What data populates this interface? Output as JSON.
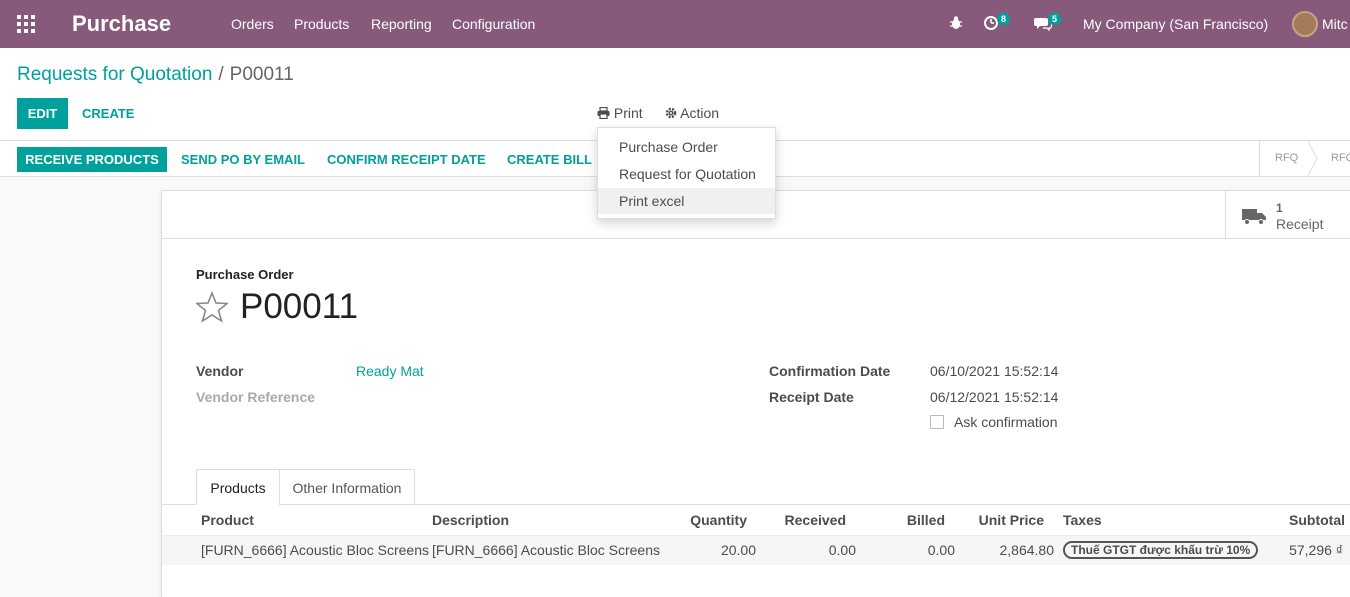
{
  "navbar": {
    "app_name": "Purchase",
    "menus": [
      "Orders",
      "Products",
      "Reporting",
      "Configuration"
    ],
    "activity_count": "8",
    "message_count": "5",
    "company": "My Company (San Francisco)",
    "user": "Mitc"
  },
  "breadcrumb": {
    "parent": "Requests for Quotation",
    "separator": "/",
    "current": "P00011"
  },
  "toolbar": {
    "edit_label": "EDIT",
    "create_label": "CREATE",
    "print_label": "Print",
    "action_label": "Action"
  },
  "print_menu": {
    "items": [
      "Purchase Order",
      "Request for Quotation",
      "Print excel"
    ]
  },
  "statusbar": {
    "buttons": [
      "RECEIVE PRODUCTS",
      "SEND PO BY EMAIL",
      "CONFIRM RECEIPT DATE",
      "CREATE BILL"
    ],
    "stages": [
      "RFQ",
      "RFQ"
    ]
  },
  "smart_button": {
    "count": "1",
    "label": "Receipt"
  },
  "form": {
    "title_label": "Purchase Order",
    "name": "P00011",
    "vendor_label": "Vendor",
    "vendor_value": "Ready Mat",
    "vendor_ref_label": "Vendor Reference",
    "confirmation_date_label": "Confirmation Date",
    "confirmation_date_value": "06/10/2021 15:52:14",
    "receipt_date_label": "Receipt Date",
    "receipt_date_value": "06/12/2021 15:52:14",
    "ask_confirmation_label": "Ask confirmation"
  },
  "tabs": [
    "Products",
    "Other Information"
  ],
  "table": {
    "headers": [
      "Product",
      "Description",
      "Quantity",
      "Received",
      "Billed",
      "Unit Price",
      "Taxes",
      "Subtotal"
    ],
    "rows": [
      {
        "product": "[FURN_6666] Acoustic Bloc Screens",
        "description": "[FURN_6666] Acoustic Bloc Screens",
        "quantity": "20.00",
        "received": "0.00",
        "billed": "0.00",
        "unit_price": "2,864.80",
        "taxes": "Thuế GTGT được khấu trừ 10%",
        "subtotal": "57,296 ₫"
      }
    ]
  },
  "colors": {
    "navbar": "#875a7b",
    "primary": "#00a09d"
  }
}
